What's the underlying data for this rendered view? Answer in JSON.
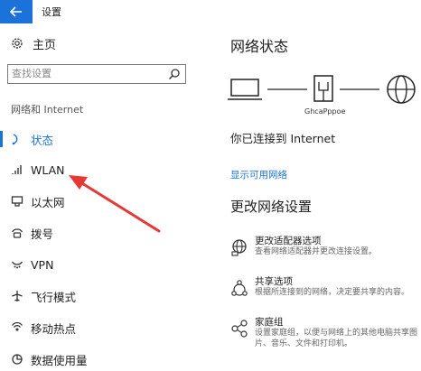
{
  "window": {
    "title": "设置",
    "back_icon": "back-arrow-icon",
    "accent_color": "#1b73d9"
  },
  "sidebar": {
    "home_label": "主页",
    "search_placeholder": "查找设置",
    "section_title": "网络和 Internet",
    "items": [
      {
        "label": "状态",
        "icon": "status-icon",
        "active": true
      },
      {
        "label": "WLAN",
        "icon": "wifi-icon",
        "active": false
      },
      {
        "label": "以太网",
        "icon": "ethernet-icon",
        "active": false
      },
      {
        "label": "拨号",
        "icon": "dialup-icon",
        "active": false
      },
      {
        "label": "VPN",
        "icon": "vpn-icon",
        "active": false
      },
      {
        "label": "飞行模式",
        "icon": "airplane-icon",
        "active": false
      },
      {
        "label": "移动热点",
        "icon": "hotspot-icon",
        "active": false
      },
      {
        "label": "数据使用量",
        "icon": "data-usage-icon",
        "active": false
      }
    ]
  },
  "main": {
    "title": "网络状态",
    "network_name": "GhcaPppoe",
    "connected_text": "你已连接到 Internet",
    "show_networks_link": "显示可用网络",
    "change_settings_title": "更改网络设置",
    "options": [
      {
        "title": "更改适配器选项",
        "desc": "查看网络适配器并更改连接设置。",
        "icon": "adapter-icon"
      },
      {
        "title": "共享选项",
        "desc": "根据所连接到的网络，决定要共享的内容。",
        "icon": "sharing-icon"
      },
      {
        "title": "家庭组",
        "desc": "设置家庭组，以便与网络上的其他电脑共享图片、音乐、文件和打印机。",
        "icon": "homegroup-icon"
      }
    ]
  },
  "annotation": {
    "arrow_color": "#e53935"
  }
}
